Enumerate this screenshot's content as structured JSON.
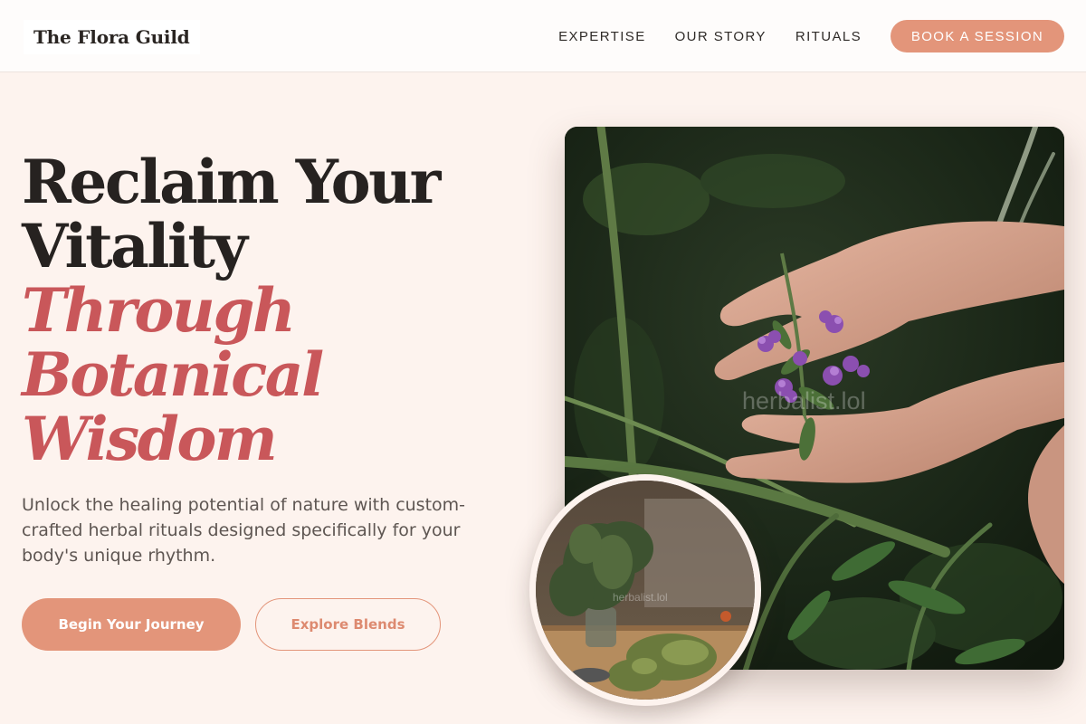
{
  "brand": {
    "name": "The Flora Guild"
  },
  "nav": {
    "links": [
      "EXPERTISE",
      "OUR STORY",
      "RITUALS"
    ],
    "cta_label": "BOOK A SESSION"
  },
  "hero": {
    "headline_lines": [
      "Reclaim Your",
      "Vitality"
    ],
    "headline_accent_lines": [
      "Through",
      "Botanical",
      "Wisdom"
    ],
    "subtext": "Unlock the healing potential of nature with custom-crafted herbal rituals designed specifically for your body's unique rhythm.",
    "primary_button": "Begin Your Journey",
    "secondary_button": "Explore Blends"
  },
  "images": {
    "main_watermark": "herbalist.lol",
    "round_watermark": "herbalist.lol"
  },
  "colors": {
    "accent": "#e3957a",
    "headline_accent": "#c9575a",
    "background": "#fdf3ee",
    "text_dark": "#262220"
  }
}
